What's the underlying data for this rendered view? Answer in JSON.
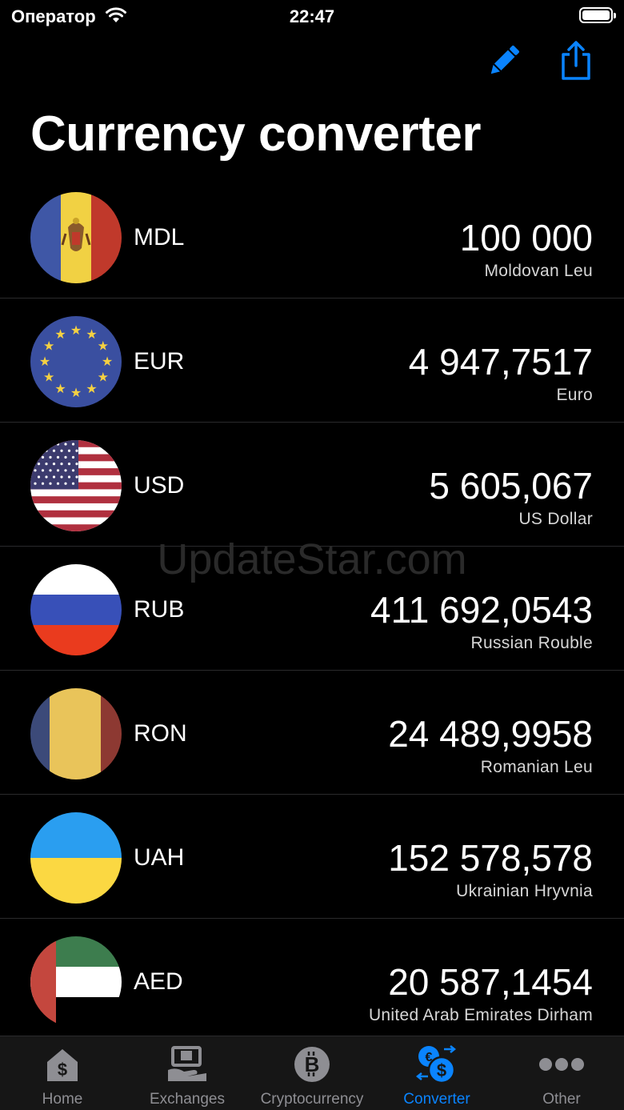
{
  "status_bar": {
    "carrier": "Оператор",
    "time": "22:47"
  },
  "header": {
    "title": "Currency converter",
    "edit_icon": "pencil-icon",
    "share_icon": "share-icon"
  },
  "watermark": "UpdateStar.com",
  "currencies": [
    {
      "code": "MDL",
      "amount": "100 000",
      "name": "Moldovan Leu",
      "flag": "moldova-flag-icon"
    },
    {
      "code": "EUR",
      "amount": "4 947,7517",
      "name": "Euro",
      "flag": "eu-flag-icon"
    },
    {
      "code": "USD",
      "amount": "5 605,067",
      "name": "US Dollar",
      "flag": "usa-flag-icon"
    },
    {
      "code": "RUB",
      "amount": "411 692,0543",
      "name": "Russian Rouble",
      "flag": "russia-flag-icon"
    },
    {
      "code": "RON",
      "amount": "24 489,9958",
      "name": "Romanian Leu",
      "flag": "romania-flag-icon"
    },
    {
      "code": "UAH",
      "amount": "152 578,578",
      "name": "Ukrainian Hryvnia",
      "flag": "ukraine-flag-icon"
    },
    {
      "code": "AED",
      "amount": "20 587,1454",
      "name": "United Arab Emirates Dirham",
      "flag": "uae-flag-icon"
    }
  ],
  "tabs": [
    {
      "label": "Home",
      "icon": "home-dollar-icon",
      "active": false
    },
    {
      "label": "Exchanges",
      "icon": "exchange-office-icon",
      "active": false
    },
    {
      "label": "Cryptocurrency",
      "icon": "bitcoin-icon",
      "active": false
    },
    {
      "label": "Converter",
      "icon": "currency-swap-icon",
      "active": true
    },
    {
      "label": "Other",
      "icon": "more-icon",
      "active": false
    }
  ],
  "colors": {
    "accent": "#0a84ff",
    "background": "#000000",
    "tab_bar": "#161616",
    "inactive_tab": "#8e8e93"
  }
}
